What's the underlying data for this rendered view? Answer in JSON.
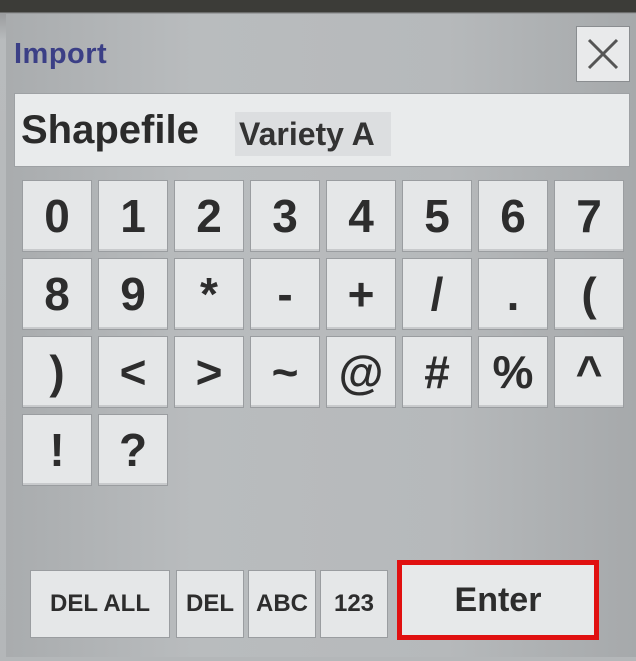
{
  "dialog": {
    "title": "Import",
    "close_icon": "close-icon"
  },
  "input": {
    "label": "Shapefile",
    "value": "Variety A"
  },
  "keypad": {
    "rows": [
      [
        "0",
        "1",
        "2",
        "3",
        "4",
        "5",
        "6",
        "7"
      ],
      [
        "8",
        "9",
        "*",
        "-",
        "+",
        "/",
        ".",
        "("
      ],
      [
        ")",
        "<",
        ">",
        "~",
        "@",
        "#",
        "%",
        "^"
      ],
      [
        "!",
        "?"
      ]
    ]
  },
  "bottom_bar": {
    "del_all": "DEL ALL",
    "del": "DEL",
    "abc": "ABC",
    "num": "123",
    "enter": "Enter"
  },
  "highlight_color": "#e01010"
}
